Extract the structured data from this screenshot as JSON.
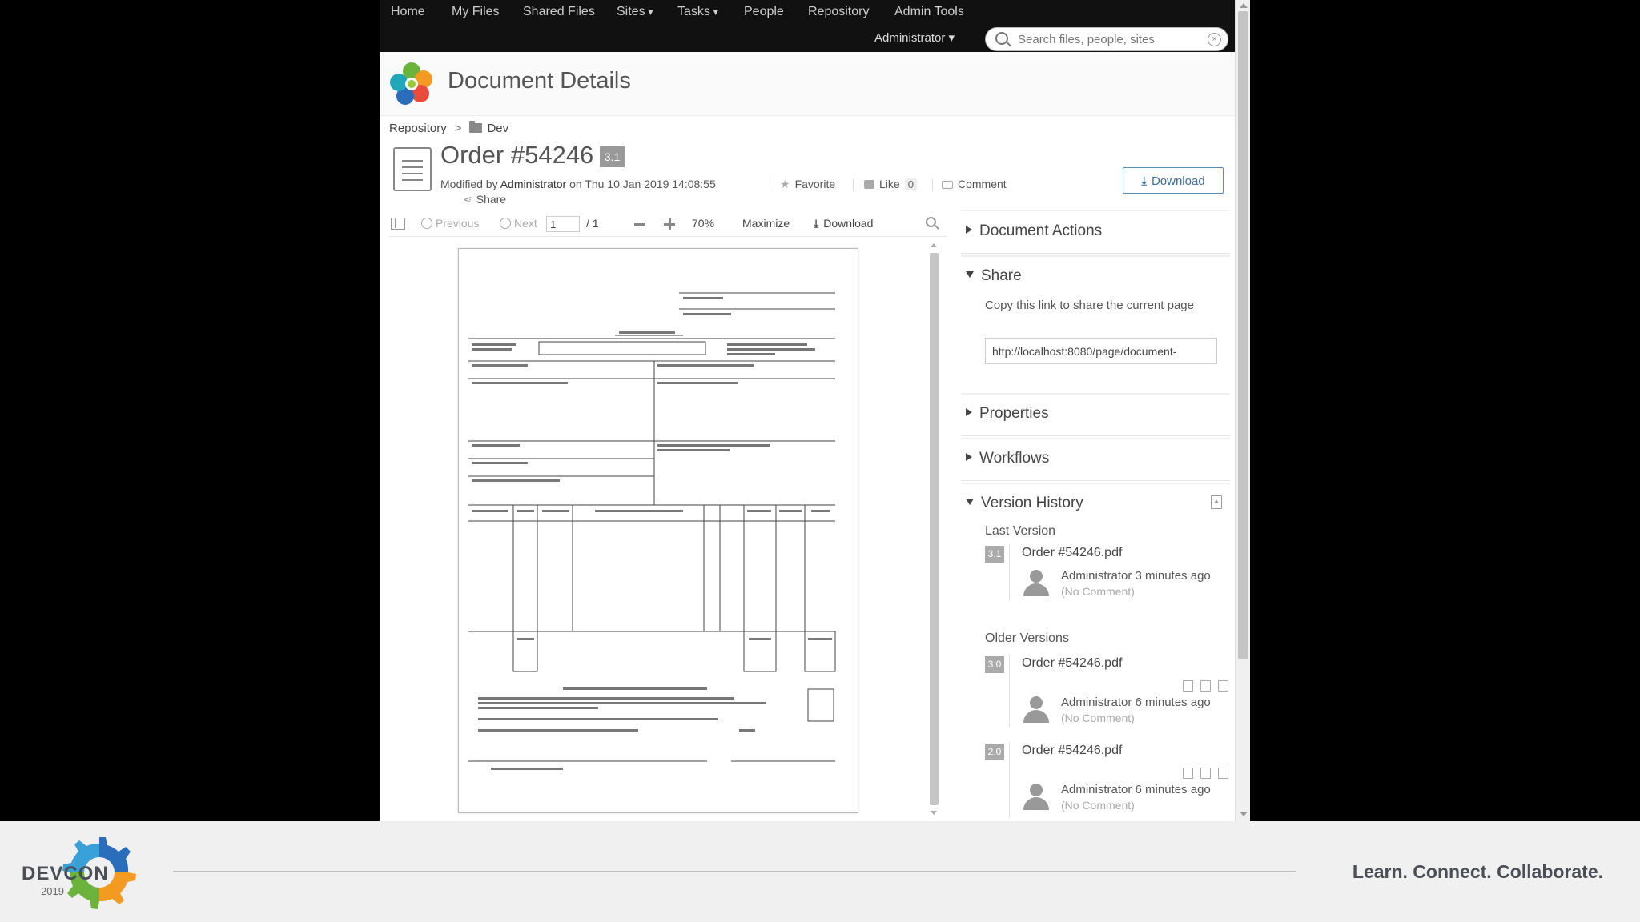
{
  "nav": {
    "items": [
      "Home",
      "My Files",
      "Shared Files",
      "Sites",
      "Tasks",
      "People",
      "Repository",
      "Admin Tools"
    ],
    "user_menu": "Administrator",
    "search_placeholder": "Search files, people, sites"
  },
  "header": {
    "title": "Document Details"
  },
  "breadcrumb": {
    "root": "Repository",
    "separator": ">",
    "folder": "Dev"
  },
  "document": {
    "title": "Order #54246",
    "version": "3.1",
    "modified_prefix": "Modified by",
    "modified_by": "Administrator",
    "modified_on": "on Thu 10 Jan 2019 14:08:55",
    "favorite_label": "Favorite",
    "like_label": "Like",
    "like_count": "0",
    "comment_label": "Comment",
    "share_label": "Share",
    "download_label": "Download"
  },
  "viewer": {
    "previous": "Previous",
    "next": "Next",
    "page_current": "1",
    "page_total": "/ 1",
    "zoom": "70%",
    "maximize": "Maximize",
    "download": "Download"
  },
  "panel": {
    "document_actions": "Document Actions",
    "share": {
      "title": "Share",
      "description": "Copy this link to share the current page",
      "link": "http://localhost:8080/page/document-"
    },
    "properties": "Properties",
    "workflows": "Workflows",
    "version_history": {
      "title": "Version History",
      "last_label": "Last Version",
      "older_label": "Older Versions",
      "versions": [
        {
          "badge": "3.1",
          "name": "Order #54246.pdf",
          "who": "Administrator 3 minutes ago",
          "comment": "(No Comment)"
        },
        {
          "badge": "3.0",
          "name": "Order #54246.pdf",
          "who": "Administrator 6 minutes ago",
          "comment": "(No Comment)"
        },
        {
          "badge": "2.0",
          "name": "Order #54246.pdf",
          "who": "Administrator 6 minutes ago",
          "comment": "(No Comment)"
        }
      ]
    }
  },
  "footer": {
    "logo_text": "DEVCON",
    "logo_year": "2019",
    "tagline": "Learn. Connect. Collaborate."
  },
  "colors": {
    "accent_blue": "#3c6e9f",
    "topbar": "#111111",
    "logo_green": "#6bb33c",
    "logo_blue": "#2a6ebb",
    "logo_orange": "#f39a21"
  }
}
